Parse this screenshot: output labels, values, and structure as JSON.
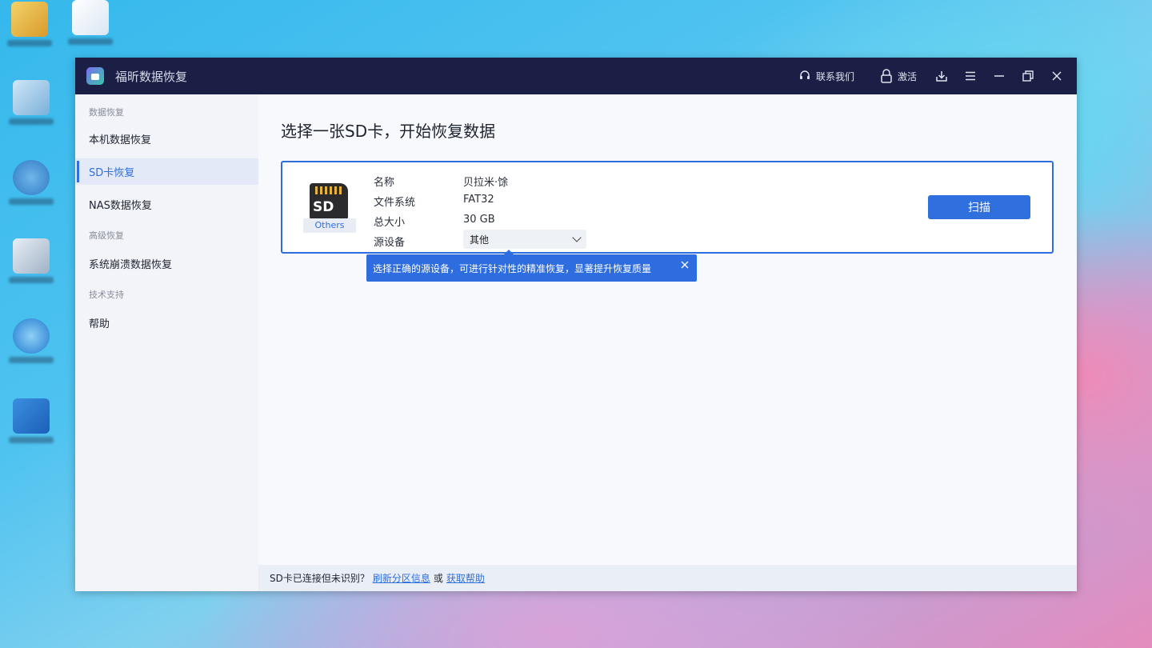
{
  "app": {
    "title": "福昕数据恢复"
  },
  "titlebar": {
    "contact_label": "联系我们",
    "activate_label": "激活"
  },
  "sidebar": {
    "groups": [
      {
        "title": "数据恢复",
        "items": [
          {
            "label": "本机数据恢复"
          },
          {
            "label": "SD卡恢复",
            "active": true
          },
          {
            "label": "NAS数据恢复"
          }
        ]
      },
      {
        "title": "高级恢复",
        "items": [
          {
            "label": "系统崩溃数据恢复"
          }
        ]
      },
      {
        "title": "技术支持",
        "items": [
          {
            "label": "帮助"
          }
        ]
      }
    ]
  },
  "main": {
    "title": "选择一张SD卡，开始恢复数据",
    "device": {
      "icon_label": "SD",
      "badge": "Others",
      "name_label": "名称",
      "name_value": "贝拉米·馀",
      "fs_label": "文件系统",
      "fs_value": "FAT32",
      "size_label": "总大小",
      "size_value": "30 GB",
      "source_label": "源设备",
      "source_value": "其他"
    },
    "scan_label": "扫描",
    "tooltip": "选择正确的源设备，可进行针对性的精准恢复，显著提升恢复质量"
  },
  "footer": {
    "prefix": "SD卡已连接但未识别？",
    "refresh_link": "刷新分区信息",
    "or": "或",
    "help_link": "获取帮助"
  },
  "colors": {
    "accent": "#2f6fde",
    "titlebar": "#1b1f45"
  }
}
